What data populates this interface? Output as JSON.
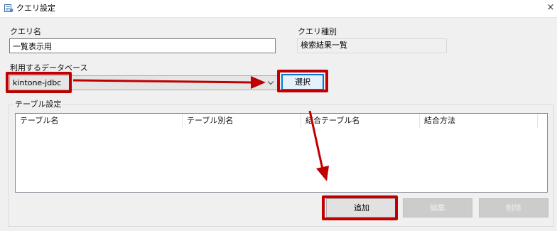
{
  "window": {
    "title": "クエリ設定",
    "close_symbol": "×"
  },
  "form": {
    "query_name_label": "クエリ名",
    "query_name_value": "一覧表示用",
    "query_type_label": "クエリ種別",
    "query_type_value": "検索結果一覧",
    "database_label": "利用するデータベース",
    "database_value": "kintone-jdbc",
    "select_button": "選択"
  },
  "table_settings": {
    "group_title": "テーブル設定",
    "columns": [
      "テーブル名",
      "テーブル別名",
      "結合テーブル名",
      "結合方法"
    ],
    "rows": []
  },
  "buttons": {
    "add": "追加",
    "edit": "編集",
    "delete": "削除"
  },
  "annotation": {
    "color": "#c00000"
  }
}
